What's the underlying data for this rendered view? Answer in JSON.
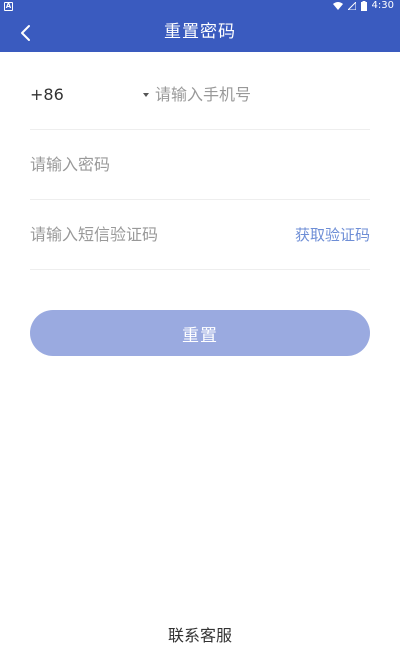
{
  "status_bar": {
    "badge": "A",
    "time": "4:30",
    "icons": [
      "wifi-icon",
      "signal-icon",
      "battery-icon"
    ]
  },
  "header": {
    "title": "重置密码",
    "back_icon": "chevron-left-icon"
  },
  "form": {
    "country_code": "+86",
    "phone_placeholder": "请输入手机号",
    "password_placeholder": "请输入密码",
    "sms_code_placeholder": "请输入短信验证码",
    "get_code_label": "获取验证码"
  },
  "actions": {
    "reset_label": "重置"
  },
  "footer": {
    "contact_label": "联系客服"
  },
  "colors": {
    "primary": "#3a5bbf",
    "button_disabled": "#9aaae0",
    "link": "#6e8ed6",
    "placeholder": "#999999",
    "text": "#333333"
  }
}
